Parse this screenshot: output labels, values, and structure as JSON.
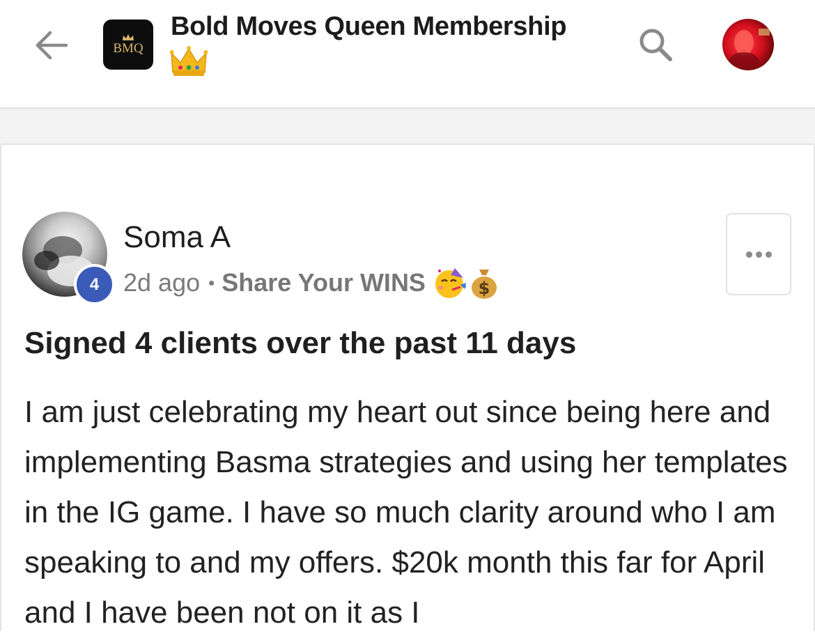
{
  "header": {
    "back_icon": "arrow-left-icon",
    "group_logo_text": "BMQ",
    "group_title": "Bold Moves Queen Membership",
    "title_emoji": "crown-emoji",
    "search_icon": "search-icon",
    "avatar_icon": "user-avatar"
  },
  "post": {
    "author": {
      "name": "Soma A",
      "level": "4"
    },
    "time_ago": "2d ago",
    "separator": "•",
    "category": "Share Your WINS",
    "category_emojis": [
      "partying-face-emoji",
      "money-bag-emoji"
    ],
    "more_icon": "more-horizontal-icon",
    "title": "Signed 4 clients over the past 11 days",
    "body": "I am just celebrating my heart out since being here and implementing Basma strategies and using her templates in the IG game. I have so much clarity around who I am speaking to and my offers. $20k month this far for April and I have been not on it as I"
  },
  "colors": {
    "level_badge": "#3b5bb8",
    "logo_background": "#0d0d0d",
    "logo_gold": "#d9b56a",
    "meta_text": "#7b7b7b"
  }
}
